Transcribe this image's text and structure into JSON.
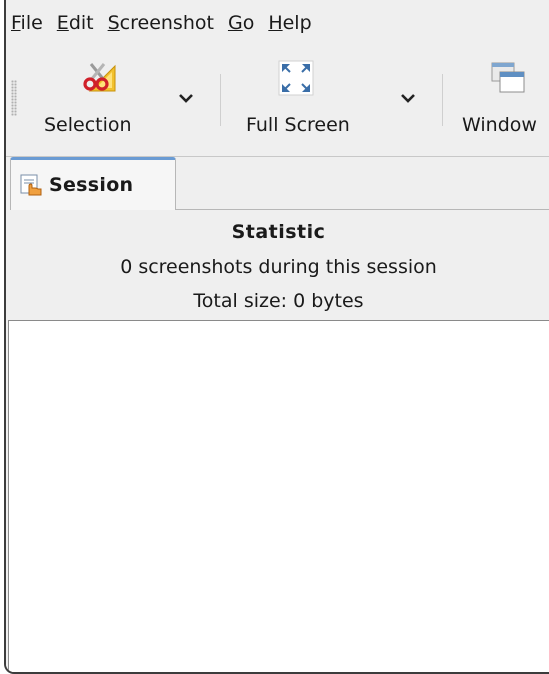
{
  "menubar": {
    "items": [
      {
        "mnemonic": "F",
        "rest": "ile"
      },
      {
        "mnemonic": "E",
        "rest": "dit"
      },
      {
        "mnemonic": "S",
        "rest": "creenshot"
      },
      {
        "mnemonic": "G",
        "rest": "o"
      },
      {
        "mnemonic": "H",
        "rest": "elp"
      }
    ]
  },
  "toolbar": {
    "selection_label": "Selection",
    "fullscreen_label": "Full Screen",
    "window_label": "Window",
    "selection_icon": "scissors-selection-icon",
    "fullscreen_icon": "fullscreen-arrows-icon",
    "window_icon": "window-icon"
  },
  "tabs": {
    "session_label": "Session",
    "session_icon": "session-hand-icon"
  },
  "statistic": {
    "title": "Statistic",
    "count_text": "0 screenshots during this session",
    "size_text": "Total size: 0 bytes"
  },
  "colors": {
    "accent": "#6a9bd3",
    "window_bg": "#efefef",
    "list_bg": "#ffffff"
  }
}
